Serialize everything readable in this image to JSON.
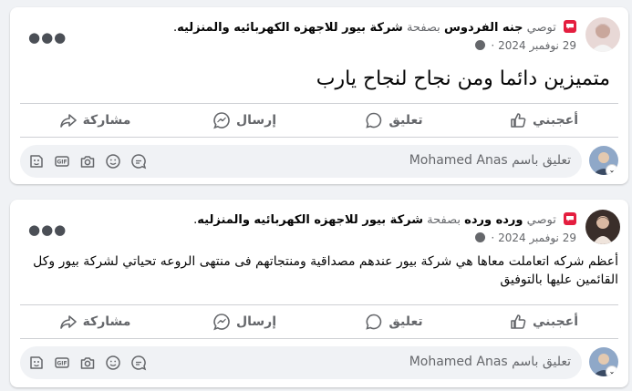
{
  "posts": [
    {
      "recommends_label": "توصي",
      "author": "جنه الفردوس",
      "on_page_label": "بصفحة",
      "page_name": "شركة بيور للاجهزه الكهربائيه والمنزليه",
      "suffix": ".",
      "date": "29 نوفمبر 2024",
      "date_sep": "·",
      "text": "متميزين دائما ومن نجاح لنجاح يارب",
      "actions": {
        "like": "أعجبني",
        "comment": "تعليق",
        "send": "إرسال",
        "share": "مشاركة"
      },
      "comment_placeholder": "تعليق باسم Mohamed Anas"
    },
    {
      "recommends_label": "توصي",
      "author": "ورده ورده",
      "on_page_label": "بصفحة",
      "page_name": "شركة بيور للاجهزه الكهربائيه والمنزليه",
      "suffix": ".",
      "date": "29 نوفمبر 2024",
      "date_sep": "·",
      "text": "أعظم شركه اتعاملت معاها هي شركة بيور عندهم مصداقية ومنتجاتهم فى منتهى الروعه تحياتي لشركة بيور وكل القائمين عليها بالتوفيق",
      "actions": {
        "like": "أعجبني",
        "comment": "تعليق",
        "send": "إرسال",
        "share": "مشاركة"
      },
      "comment_placeholder": "تعليق باسم Mohamed Anas"
    }
  ],
  "colors": {
    "badge": "#e41e3f",
    "muted": "#65676b",
    "background": "#f0f2f5"
  },
  "icons": [
    "more-icon",
    "globe-icon",
    "like-icon",
    "comment-icon",
    "send-icon",
    "share-icon",
    "sticker-icon",
    "gif-icon",
    "camera-icon",
    "emoji-icon",
    "avatar-sticker-icon"
  ]
}
